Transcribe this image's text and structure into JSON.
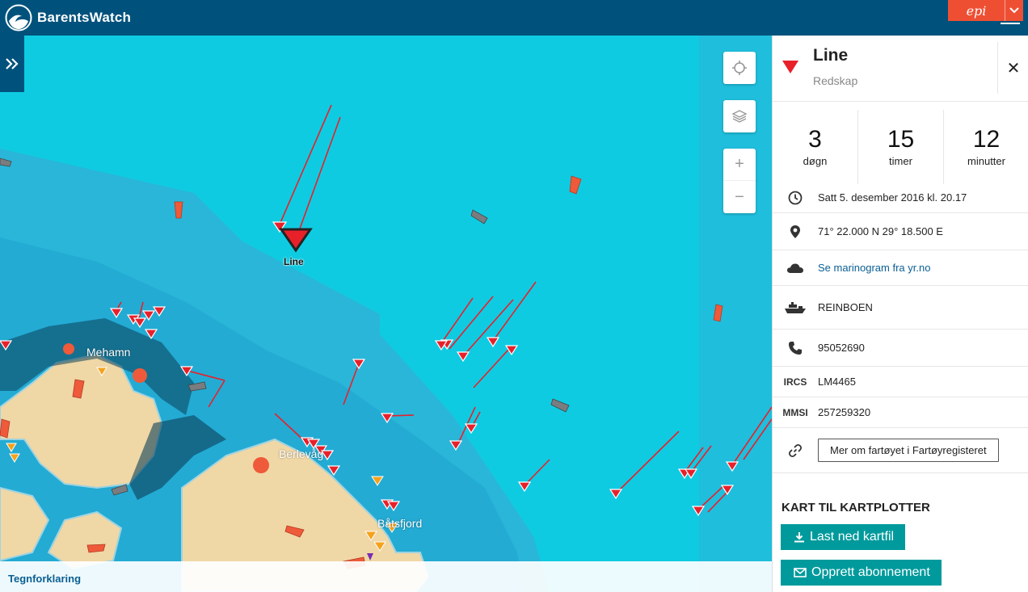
{
  "header": {
    "brand_name": "BarentsWatch",
    "partner_logo": "epi"
  },
  "map": {
    "place_labels": [
      "Mehamn",
      "Berlevåg",
      "Båtsfjord"
    ],
    "selected_vessel_label": "Line",
    "legend_link": "Tegnforklaring"
  },
  "panel": {
    "title": "Line",
    "subtitle": "Redskap",
    "age": [
      {
        "value": "3",
        "unit": "døgn"
      },
      {
        "value": "15",
        "unit": "timer"
      },
      {
        "value": "12",
        "unit": "minutter"
      }
    ],
    "datetime": "Satt 5. desember 2016 kl. 20.17",
    "position": "71° 22.000 N 29° 18.500 E",
    "weather_link": "Se marinogram fra yr.no",
    "vessel_name": "REINBOEN",
    "phone": "95052690",
    "ircs_label": "IRCS",
    "ircs": "LM4465",
    "mmsi_label": "MMSI",
    "mmsi": "257259320",
    "register_button": "Mer om fartøyet i Fartøyregisteret",
    "section_title": "KART TIL KARTPLOTTER",
    "download_button": "Last ned kartfil",
    "subscribe_button": "Opprett abonnement"
  },
  "colors": {
    "header_bg": "#00527c",
    "sea": "#0fcbe2",
    "land": "#f0d7a6",
    "gear_marker": "#e8202a",
    "button_teal": "#009a9c",
    "partner_orange": "#ee4f33"
  }
}
